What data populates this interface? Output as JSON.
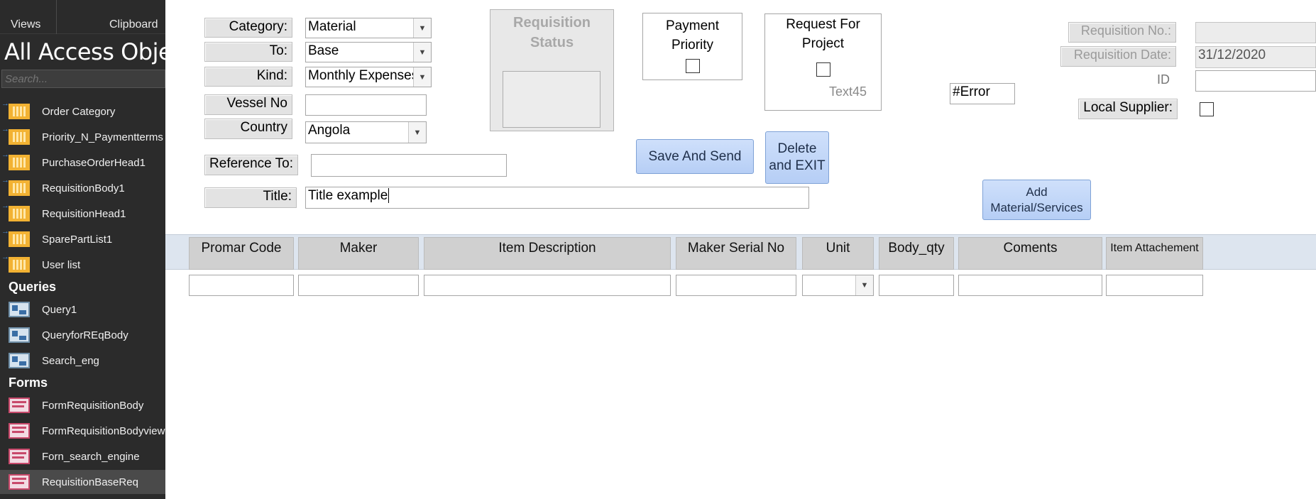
{
  "nav": {
    "ribbon_views": "Views",
    "ribbon_clipboard": "Clipboard",
    "title": "All Access Objects",
    "search_placeholder": "Search...",
    "tables": [
      {
        "label": "Order Category",
        "icon": "table-icon"
      },
      {
        "label": "Priority_N_Paymentterms",
        "icon": "table-icon"
      },
      {
        "label": "PurchaseOrderHead1",
        "icon": "table-icon"
      },
      {
        "label": "RequisitionBody1",
        "icon": "table-icon"
      },
      {
        "label": "RequisitionHead1",
        "icon": "table-icon"
      },
      {
        "label": "SparePartList1",
        "icon": "table-icon"
      },
      {
        "label": "User list",
        "icon": "table-icon"
      }
    ],
    "queries_header": "Queries",
    "queries": [
      {
        "label": "Query1",
        "icon": "query-icon"
      },
      {
        "label": "QueryforREqBody",
        "icon": "query-icon"
      },
      {
        "label": "Search_eng",
        "icon": "query-icon"
      }
    ],
    "forms_header": "Forms",
    "forms": [
      {
        "label": "FormRequisitionBody",
        "icon": "form-icon"
      },
      {
        "label": "FormRequisitionBodyview",
        "icon": "form-icon"
      },
      {
        "label": "Forn_search_engine",
        "icon": "form-icon"
      },
      {
        "label": "RequisitionBaseReq",
        "icon": "form-icon",
        "selected": true
      }
    ]
  },
  "form": {
    "category_label": "Category:",
    "category_value": "Material",
    "to_label": "To:",
    "to_value": "Base",
    "kind_label": "Kind:",
    "kind_value": "Monthly Expenses",
    "vessel_label": "Vessel No",
    "vessel_value": "",
    "country_label": "Country",
    "country_value": "Angola",
    "reference_label": "Reference To:",
    "reference_value": "",
    "title_label": "Title:",
    "title_value": "Title example",
    "req_status_label": "Requisition Status",
    "payment_priority_label": "Payment Priority",
    "payment_priority_checked": false,
    "request_project_label": "Request For Project",
    "request_project_checked": false,
    "text45_label": "Text45",
    "error_value": "#Error",
    "save_send_label": "Save And Send",
    "delete_exit_label": "Delete and EXIT",
    "add_material_label": "Add Material/Services",
    "req_no_label": "Requisition No.:",
    "req_no_value": "",
    "req_date_label": "Requisition Date:",
    "req_date_value": "31/12/2020",
    "id_label": "ID",
    "id_value": "",
    "local_supplier_label": "Local Supplier:",
    "local_supplier_checked": false
  },
  "grid": {
    "columns": [
      "Promar Code",
      "Maker",
      "Item Description",
      "Maker Serial No",
      "Unit",
      "Body_qty",
      "Coments",
      "Item Attachement"
    ],
    "row": [
      "",
      "",
      "",
      "",
      "",
      "",
      "",
      ""
    ]
  }
}
